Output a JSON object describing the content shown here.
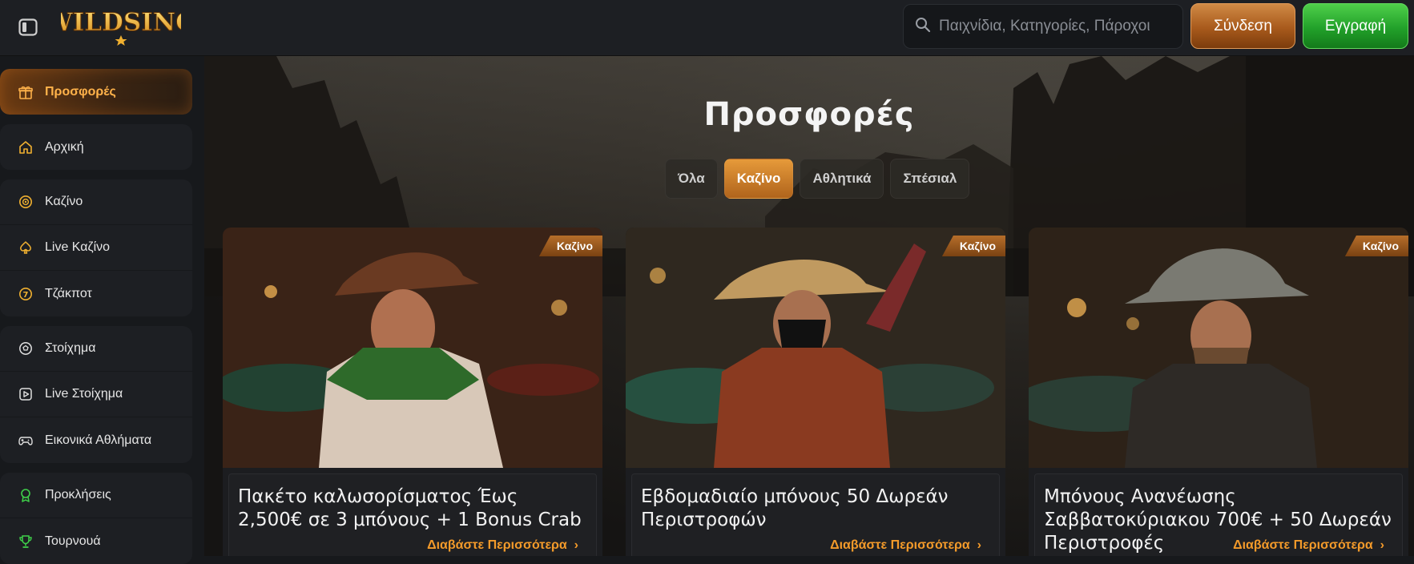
{
  "header": {
    "logo_text": "WILDSINO",
    "search_placeholder": "Παιχνίδια, Κατηγορίες, Πάροχοι",
    "login_label": "Σύνδεση",
    "register_label": "Εγγραφή"
  },
  "sidebar": {
    "groups": [
      [
        {
          "label": "Προσφορές",
          "icon": "gift-icon",
          "active": true
        }
      ],
      [
        {
          "label": "Αρχική",
          "icon": "home-icon"
        }
      ],
      [
        {
          "label": "Καζίνο",
          "icon": "casino-chip-icon"
        },
        {
          "label": "Live Καζίνο",
          "icon": "spade-icon"
        },
        {
          "label": "Τζάκποτ",
          "icon": "jackpot-icon"
        }
      ],
      [
        {
          "label": "Στοίχημα",
          "icon": "soccer-ball-icon"
        },
        {
          "label": "Live Στοίχημα",
          "icon": "play-icon"
        },
        {
          "label": "Εικονικά Αθλήματα",
          "icon": "gamepad-icon"
        }
      ],
      [
        {
          "label": "Προκλήσεις",
          "icon": "award-icon"
        },
        {
          "label": "Τουρνουά",
          "icon": "trophy-icon"
        }
      ]
    ]
  },
  "main": {
    "title": "Προσφορές",
    "tabs": [
      {
        "label": "Όλα",
        "active": false
      },
      {
        "label": "Καζίνο",
        "active": true
      },
      {
        "label": "Αθλητικά",
        "active": false
      },
      {
        "label": "Σπέσιαλ",
        "active": false
      }
    ],
    "cards": [
      {
        "badge": "Καζίνο",
        "title": "Πακέτο καλωσορίσματος Έως 2,500€ σε 3 μπόνους + 1 Bonus Crab",
        "more": "Διαβάστε Περισσότερα"
      },
      {
        "badge": "Καζίνο",
        "title": "Εβδομαδιαίο μπόνους 50 Δωρεάν Περιστροφών",
        "more": "Διαβάστε Περισσότερα"
      },
      {
        "badge": "Καζίνο",
        "title": "Μπόνους Ανανέωσης Σαββατοκύριακου 700€ + 50 Δωρεάν Περιστροφές",
        "more": "Διαβάστε Περισσότερα"
      }
    ]
  },
  "colors": {
    "accent_orange": "#f39a2a",
    "register_green": "#22a12a",
    "login_bronze": "#a85a1c",
    "background": "#17191c"
  }
}
